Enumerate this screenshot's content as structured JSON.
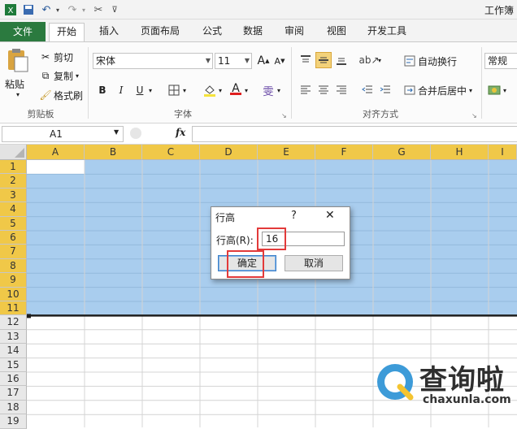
{
  "window": {
    "title": "工作簿"
  },
  "tabs": [
    "文件",
    "开始",
    "插入",
    "页面布局",
    "公式",
    "数据",
    "审阅",
    "视图",
    "开发工具"
  ],
  "clipboard": {
    "paste": "粘贴",
    "cut": "剪切",
    "copy": "复制",
    "format_painter": "格式刷",
    "group": "剪贴板"
  },
  "font": {
    "name": "宋体",
    "size": "11",
    "bold": "B",
    "italic": "I",
    "underline": "U",
    "group": "字体"
  },
  "alignment": {
    "wrap": "自动换行",
    "merge": "合并后居中",
    "group": "对齐方式"
  },
  "number": {
    "format": "常规"
  },
  "formula_bar": {
    "cell": "A1",
    "fx": "fx"
  },
  "columns": [
    "A",
    "B",
    "C",
    "D",
    "E",
    "F",
    "G",
    "H",
    "I"
  ],
  "rows": [
    "1",
    "2",
    "3",
    "4",
    "5",
    "6",
    "7",
    "8",
    "9",
    "10",
    "11",
    "12",
    "13",
    "14",
    "15",
    "16",
    "17",
    "18",
    "19"
  ],
  "selected_rows": 11,
  "dialog": {
    "title": "行高",
    "help": "?",
    "close": "✕",
    "label": "行高(R):",
    "value": "16",
    "ok": "确定",
    "cancel": "取消"
  },
  "watermark": {
    "brand": "查询啦",
    "url": "chaxunla.com"
  },
  "colors": {
    "file_tab": "#2b7a3f",
    "selection": "#a9cdee",
    "header_selected": "#f0c848",
    "highlight": "#e23a3a"
  }
}
